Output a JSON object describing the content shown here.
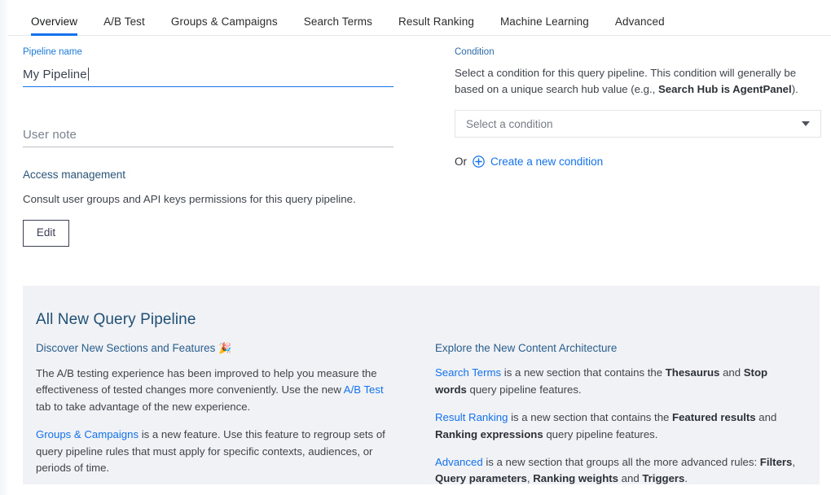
{
  "tabs": [
    {
      "label": "Overview",
      "active": true
    },
    {
      "label": "A/B Test",
      "active": false
    },
    {
      "label": "Groups & Campaigns",
      "active": false
    },
    {
      "label": "Search Terms",
      "active": false
    },
    {
      "label": "Result Ranking",
      "active": false
    },
    {
      "label": "Machine Learning",
      "active": false
    },
    {
      "label": "Advanced",
      "active": false
    }
  ],
  "form": {
    "pipeline_name_label": "Pipeline name",
    "pipeline_name_value": "My Pipeline",
    "user_note_placeholder": "User note",
    "access_management_heading": "Access management",
    "access_management_text": "Consult user groups and API keys permissions for this query pipeline.",
    "edit_button": "Edit"
  },
  "condition": {
    "label": "Condition",
    "description_part1": "Select a condition for this query pipeline. This condition will generally be based on a unique search hub value (e.g., ",
    "description_bold": "Search Hub is AgentPanel",
    "description_part2": ").",
    "select_placeholder": "Select a condition",
    "or_text": "Or",
    "create_link": "Create a new condition"
  },
  "card": {
    "title": "All New Query Pipeline",
    "left": {
      "subtitle": "Discover New Sections and Features",
      "subtitle_emoji": "🎉",
      "p1_a": "The A/B testing experience has been improved to help you measure the effectiveness of tested changes more conveniently. Use the new ",
      "p1_link": "A/B Test",
      "p1_b": " tab to take advantage of the new experience.",
      "p2_link": "Groups & Campaigns",
      "p2_a": " is a new feature. Use this feature to regroup sets of query pipeline rules that must apply for specific contexts, audiences, or periods of time."
    },
    "right": {
      "subtitle": "Explore the New Content Architecture",
      "p1_link": "Search Terms",
      "p1_a": " is a new section that contains the ",
      "p1_b1": "Thesaurus",
      "p1_mid": " and ",
      "p1_b2": "Stop words",
      "p1_end": " query pipeline features.",
      "p2_link": "Result Ranking",
      "p2_a": " is a new section that contains the ",
      "p2_b1": "Featured results",
      "p2_mid": " and ",
      "p2_b2": "Ranking expressions",
      "p2_end": " query pipeline features.",
      "p3_link": "Advanced",
      "p3_a": " is a new section that groups all the more advanced rules: ",
      "p3_b1": "Filters",
      "p3_mid1": ", ",
      "p3_b2": "Query parameters",
      "p3_mid2": ", ",
      "p3_b3": "Ranking weights",
      "p3_mid3": " and ",
      "p3_b4": "Triggers",
      "p3_end": "."
    }
  },
  "colors": {
    "accent_blue": "#1372ec",
    "link_blue": "#1372ec",
    "heading_blue": "#215075",
    "card_bg": "#f0f2f5"
  }
}
